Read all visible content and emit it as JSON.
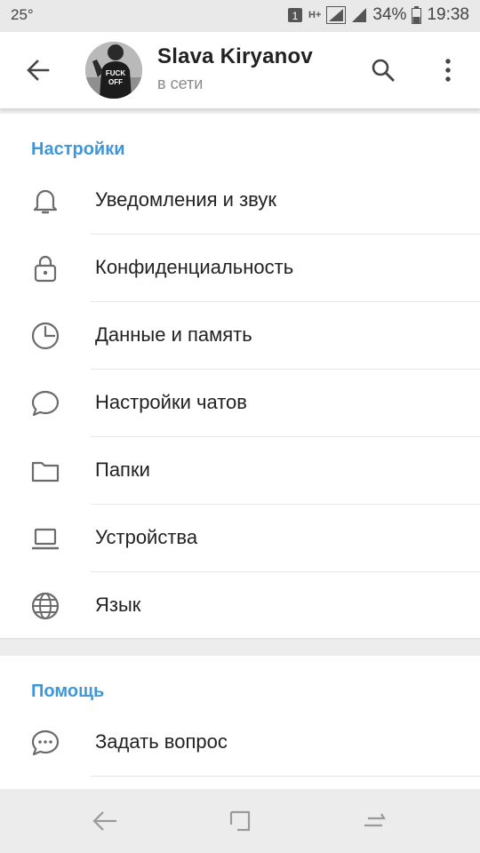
{
  "status_bar": {
    "left_text": "25°",
    "sim_label": "1",
    "network_type": "H+",
    "battery_percent": "34%",
    "time": "19:38"
  },
  "header": {
    "title": "Slava Kiryanov",
    "subtitle": "в сети",
    "avatar_text_line1": "FUCK",
    "avatar_text_line2": "OFF"
  },
  "settings": {
    "header": "Настройки",
    "items": [
      {
        "label": "Уведомления и звук",
        "icon": "bell-icon"
      },
      {
        "label": "Конфиденциальность",
        "icon": "lock-icon"
      },
      {
        "label": "Данные и память",
        "icon": "clock-pie-icon"
      },
      {
        "label": "Настройки чатов",
        "icon": "chat-bubble-icon"
      },
      {
        "label": "Папки",
        "icon": "folder-icon"
      },
      {
        "label": "Устройства",
        "icon": "laptop-icon"
      },
      {
        "label": "Язык",
        "icon": "globe-icon"
      }
    ]
  },
  "help": {
    "header": "Помощь",
    "items": [
      {
        "label": "Задать вопрос",
        "icon": "chat-dots-icon"
      }
    ]
  },
  "colors": {
    "accent": "#3f97d8",
    "text": "#222222",
    "icon": "#6b6b6b",
    "background": "#ededed"
  }
}
